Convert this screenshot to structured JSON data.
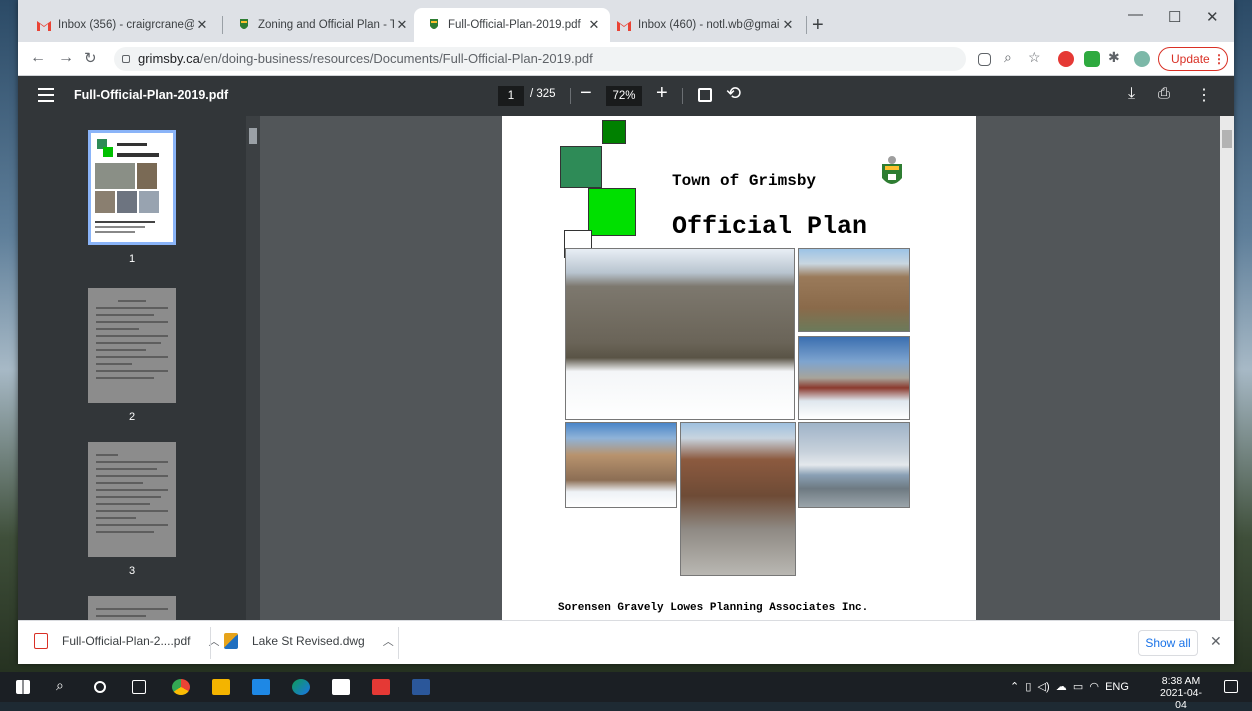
{
  "browser": {
    "tabs": [
      {
        "title": "Inbox (356) - craigrcrane@gmail",
        "icon": "gmail-icon"
      },
      {
        "title": "Zoning and Official Plan - Town o",
        "icon": "grimsby-crest-icon"
      },
      {
        "title": "Full-Official-Plan-2019.pdf",
        "icon": "grimsby-crest-icon",
        "active": true
      },
      {
        "title": "Inbox (460) - notl.wb@gmail.com",
        "icon": "gmail-icon"
      }
    ],
    "url_host": "grimsby.ca",
    "url_path": "/en/doing-business/resources/Documents/Full-Official-Plan-2019.pdf",
    "update_label": "Update"
  },
  "pdf_toolbar": {
    "filename": "Full-Official-Plan-2019.pdf",
    "current_page": "1",
    "total_pages": "/ 325",
    "zoom": "72%"
  },
  "thumbnails": [
    {
      "page": "1",
      "selected": true
    },
    {
      "page": "2"
    },
    {
      "page": "3"
    }
  ],
  "document": {
    "town_title": "Town of Grimsby",
    "plan_title": "Official Plan",
    "credit": "Sorensen Gravely Lowes Planning Associates Inc."
  },
  "downloads": {
    "items": [
      {
        "name": "Full-Official-Plan-2....pdf"
      },
      {
        "name": "Lake St Revised.dwg"
      }
    ],
    "show_all": "Show all"
  },
  "taskbar": {
    "language": "ENG",
    "time": "8:38 AM",
    "date": "2021-04-04"
  },
  "colors": {
    "accent_green": "#00c000",
    "dark_green": "#2e8b57",
    "pdf_toolbar_bg": "#323639"
  }
}
